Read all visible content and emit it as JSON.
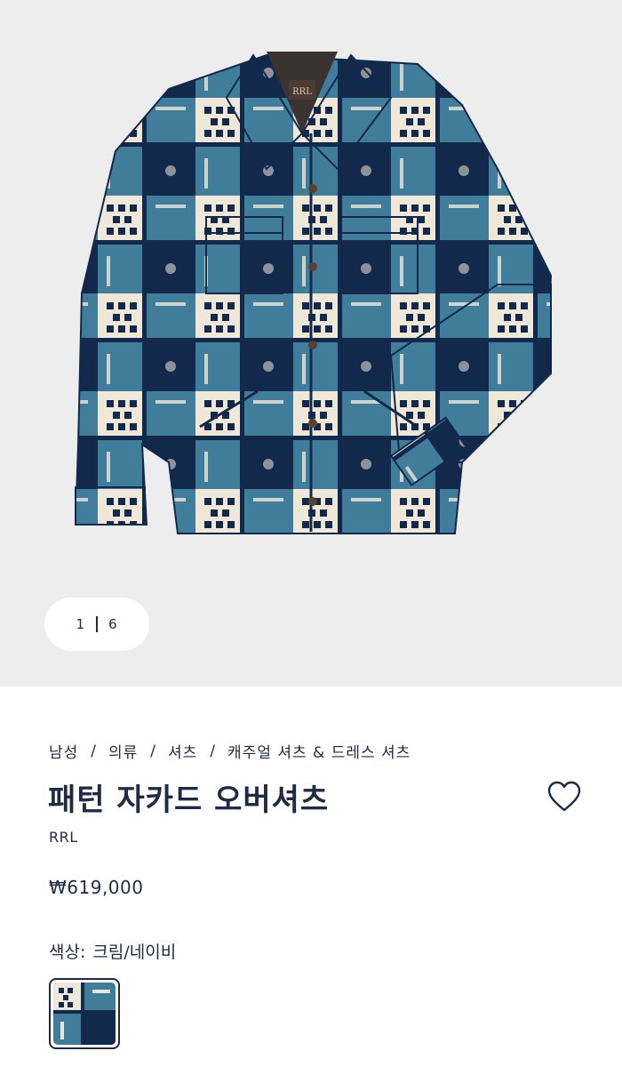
{
  "gallery": {
    "current_index": "1",
    "total_images": "6"
  },
  "breadcrumb": [
    "남성",
    "의류",
    "셔츠",
    "캐주얼 셔츠 & 드레스 셔츠"
  ],
  "product": {
    "title": "패턴 자카드 오버셔츠",
    "brand": "RRL",
    "price": "₩619,000",
    "color_label": "색상:",
    "color_value": "크림/네이비",
    "collar_label": "RRL"
  },
  "colors": {
    "text": "#1f2a44",
    "gallery_bg": "#eeeded",
    "shirt_blue": "#3f7d9a",
    "shirt_navy": "#13294b",
    "shirt_cream": "#efe8d8"
  },
  "icons": {
    "wishlist": "heart-outline-icon"
  }
}
